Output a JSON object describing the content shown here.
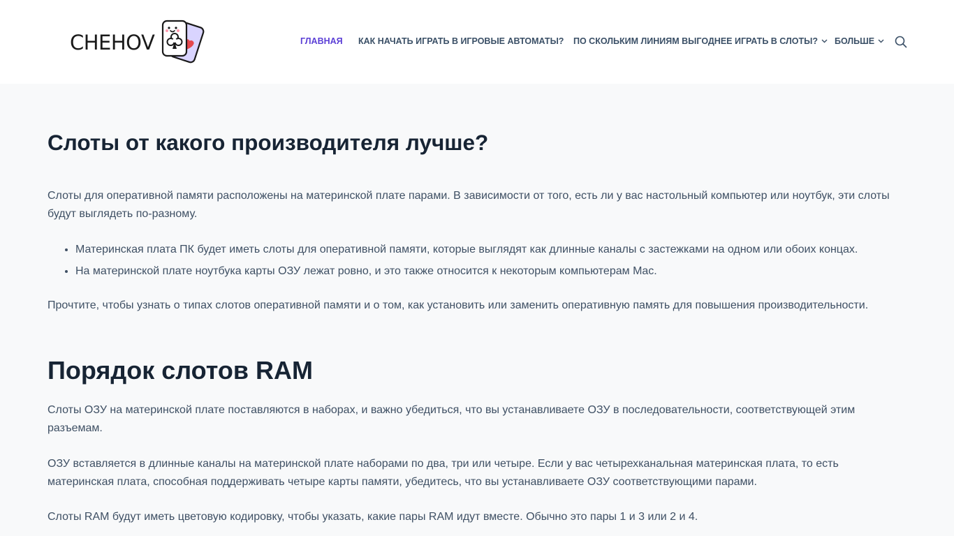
{
  "logo": {
    "text": "CHEHOV",
    "icon": "playing-cards-icon"
  },
  "nav": {
    "items": [
      {
        "label": "Главная",
        "active": true,
        "has_dropdown": false
      },
      {
        "label": "Как начать играть в игровые автоматы?",
        "active": false,
        "has_dropdown": false
      },
      {
        "label": "По скольким линиям выгоднее играть в слоты?",
        "active": false,
        "has_dropdown": true
      },
      {
        "label": "Больше",
        "active": false,
        "has_dropdown": true
      }
    ],
    "search_icon": "search-icon"
  },
  "article": {
    "section1": {
      "heading": "Слоты от какого производителя лучше?",
      "intro": "Слоты для оперативной памяти расположены на материнской плате парами. В зависимости от того, есть ли у вас настольный компьютер или ноутбук, эти слоты будут выглядеть по-разному.",
      "bullets": [
        "Материнская плата ПК будет иметь слоты для оперативной памяти, которые выглядят как длинные каналы с застежками на одном или обоих концах.",
        "На материнской плате ноутбука карты ОЗУ лежат ровно, и это также относится к некоторым компьютерам Mac."
      ],
      "outro": "Прочтите, чтобы узнать о типах слотов оперативной памяти и о том, как установить или заменить оперативную память для повышения производительности."
    },
    "section2": {
      "heading": "Порядок слотов RAM",
      "paragraphs": [
        "Слоты ОЗУ на материнской плате поставляются в наборах, и важно убедиться, что вы устанавливаете ОЗУ в последовательности, соответствующей этим разъемам.",
        "ОЗУ вставляется в длинные каналы на материнской плате наборами по два, три или четыре. Если у вас четырехканальная материнская плата, то есть материнская плата, способная поддерживать четыре карты памяти, убедитесь, что вы устанавливаете ОЗУ соответствующими парами.",
        "Слоты RAM будут иметь цветовую кодировку, чтобы указать, какие пары RAM идут вместе. Обычно это пары 1 и 3 или 2 и 4."
      ]
    }
  },
  "colors": {
    "accent": "#5b3fd6",
    "heading": "#172434",
    "body_text": "#3f5064",
    "nav_text": "#3a4f66",
    "background": "#f8f9fa",
    "header_bg": "#ffffff"
  }
}
